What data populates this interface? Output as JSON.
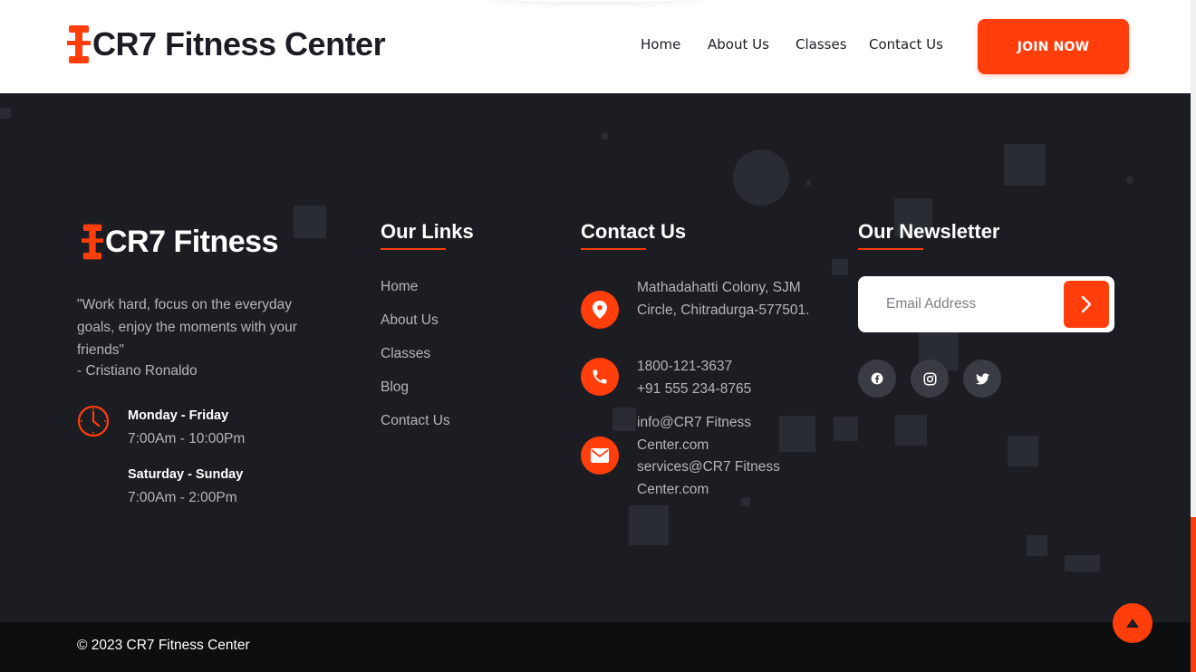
{
  "header": {
    "brand": "CR7 Fitness Center",
    "nav": [
      {
        "label": "Home"
      },
      {
        "label": "About Us"
      },
      {
        "label": "Classes"
      },
      {
        "label": "Contact Us"
      }
    ],
    "cta": "JOIN NOW"
  },
  "footer": {
    "brand": "CR7 Fitness",
    "quote": "\"Work hard, focus on the everyday goals, enjoy the moments with your friends\"",
    "quote_author": "- Cristiano Ronaldo",
    "hours": [
      {
        "days": "Monday - Friday",
        "time": "7:00Am - 10:00Pm"
      },
      {
        "days": "Saturday - Sunday",
        "time": "7:00Am - 2:00Pm"
      }
    ],
    "links_title": "Our Links",
    "links": [
      "Home",
      "About Us",
      "Classes",
      "Blog",
      "Contact Us"
    ],
    "contact_title": "Contact Us",
    "contact": {
      "address": "Mathadahatti Colony, SJM Circle, Chitradurga-577501.",
      "phone1": "1800-121-3637",
      "phone2": "+91 555 234-8765",
      "email1": "info@CR7 Fitness Center.com",
      "email2": "services@CR7 Fitness Center.com"
    },
    "newsletter_title": "Our Newsletter",
    "newsletter_placeholder": "Email Address",
    "copyright": "© 2023 CR7 Fitness Center"
  },
  "icons": {
    "logo": "dumbbell-icon",
    "clock": "clock-icon",
    "location": "location-pin-icon",
    "phone": "phone-icon",
    "mail": "mail-icon",
    "submit": "chevron-right-icon",
    "socials": [
      "facebook-icon",
      "instagram-icon",
      "twitter-icon"
    ],
    "back_to_top": "caret-up-icon"
  },
  "colors": {
    "accent": "#ff3e0c",
    "footer_bg": "#1b1d23",
    "bottom_bar_bg": "#0d0e10",
    "header_bg": "#ffffff"
  }
}
